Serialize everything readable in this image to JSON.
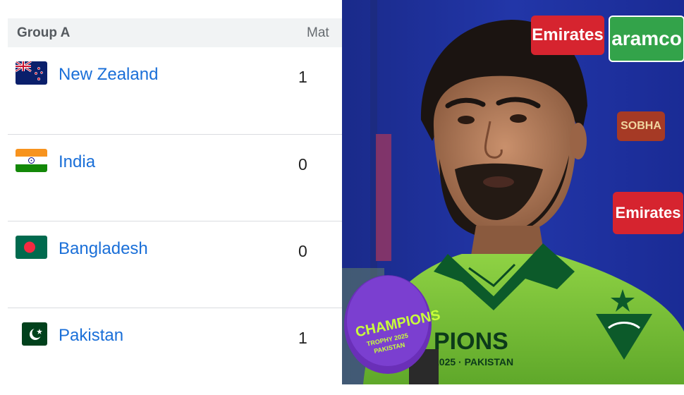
{
  "table": {
    "group_title": "Group A",
    "col_mat": "Mat",
    "rows": [
      {
        "team": "New Zealand",
        "mat": "1",
        "flag": "new-zealand-flag"
      },
      {
        "team": "India",
        "mat": "0",
        "flag": "india-flag"
      },
      {
        "team": "Bangladesh",
        "mat": "0",
        "flag": "bangladesh-flag"
      },
      {
        "team": "Pakistan",
        "mat": "1",
        "flag": "pakistan-flag"
      }
    ]
  },
  "photo": {
    "sponsors": {
      "emirates": "Emirates",
      "aramco": "aramco",
      "sobha": "SOBHA"
    },
    "mic": {
      "line1": "CHAMPIONS",
      "line2": "TROPHY 2025",
      "line3": "PAKISTAN"
    },
    "jersey": {
      "line1": "PIONS",
      "line2": "2025 · PAKISTAN"
    }
  },
  "colors": {
    "link_blue": "#1a6fd8",
    "header_bg": "#f1f3f4",
    "jersey_green": "#7fc43a",
    "backdrop_blue": "#1f2fa3"
  }
}
